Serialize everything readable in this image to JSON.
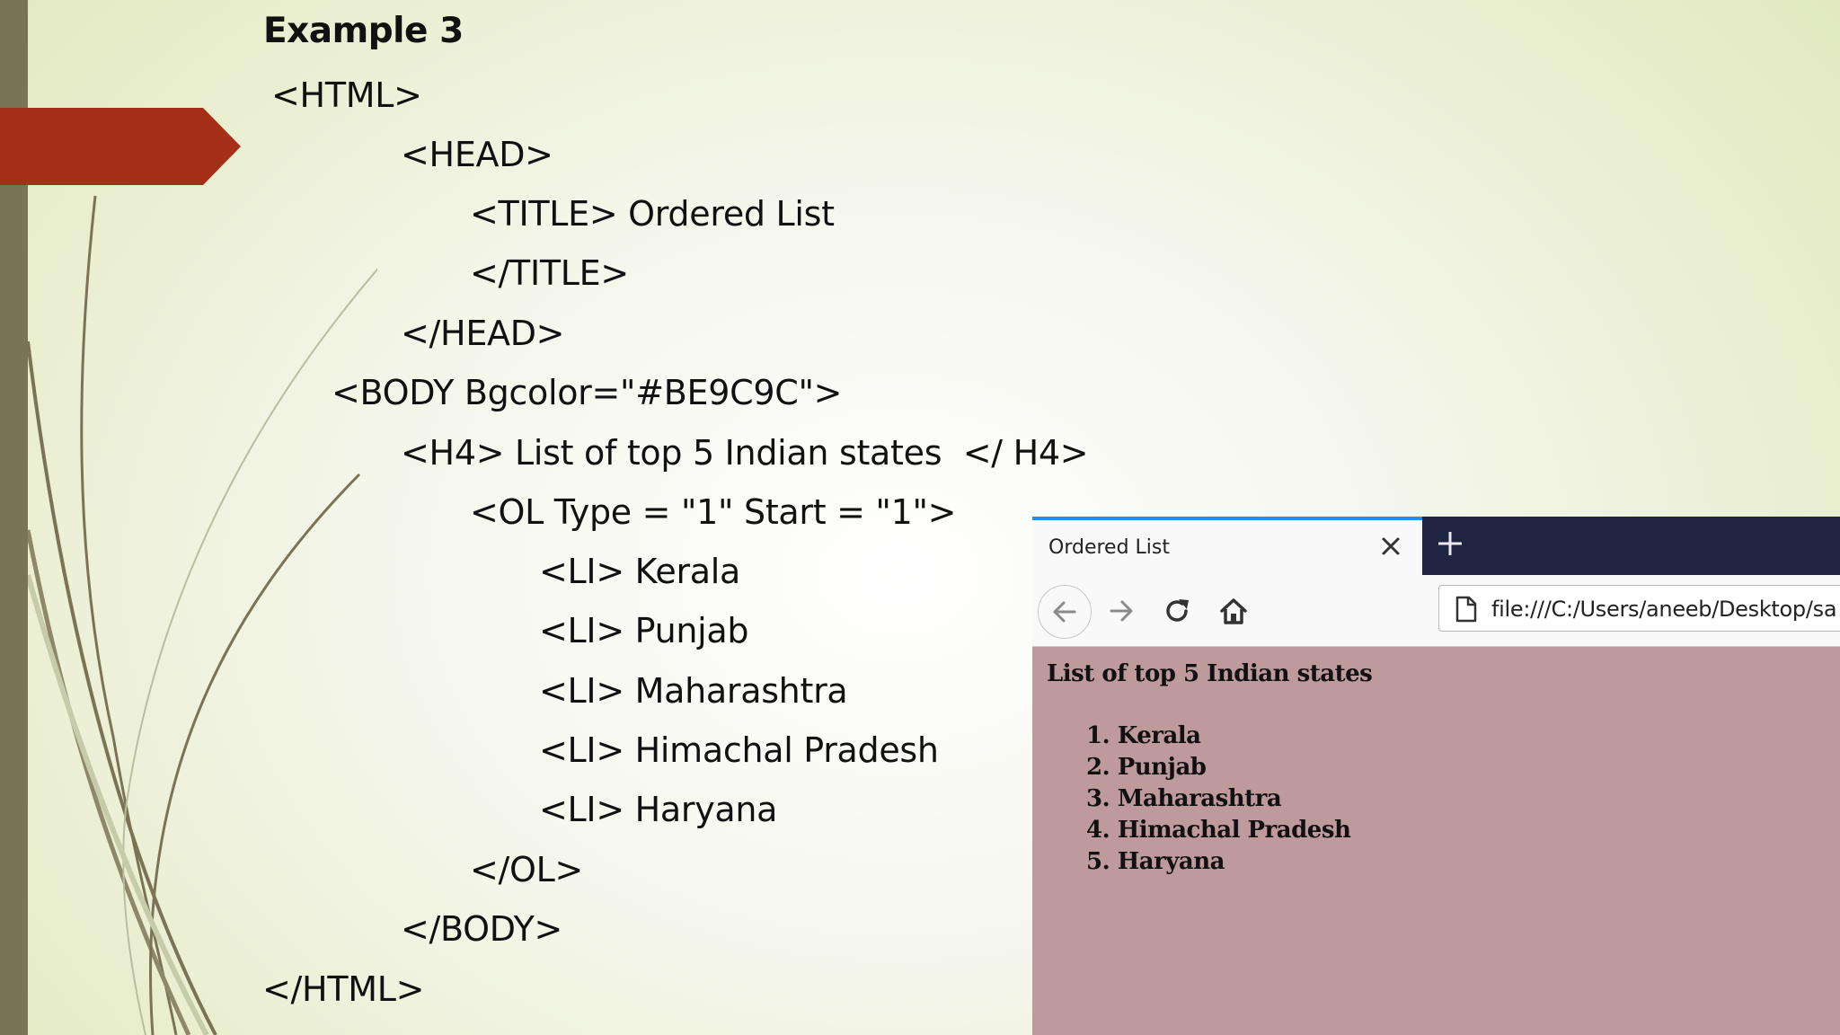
{
  "slide": {
    "title": "Example 3",
    "code_lines": [
      "<HTML>",
      "<HEAD>",
      "<TITLE> Ordered List",
      "</TITLE>",
      "</HEAD>",
      "<BODY Bgcolor=\"#BE9C9C\">",
      "<H4> List of top 5 Indian states  </ H4>",
      "<OL Type = \"1\" Start = \"1\">",
      "<LI> Kerala",
      "<LI> Punjab",
      "<LI> Maharashtra",
      "<LI> Himachal Pradesh",
      "<LI> Haryana",
      "</OL>",
      "</BODY>",
      "</HTML>"
    ],
    "colors": {
      "accent_arrow": "#a52f17",
      "left_bar": "#7b7356"
    }
  },
  "browser": {
    "tab_title": "Ordered List",
    "url": "file:///C:/Users/aneeb/Desktop/sa",
    "icons": {
      "close": "close-icon",
      "new_tab": "plus-icon",
      "back": "back-arrow-icon",
      "forward": "forward-arrow-icon",
      "reload": "reload-icon",
      "home": "home-icon",
      "page": "page-icon"
    },
    "page_bgcolor": "#BE9C9C",
    "page": {
      "heading": "List of top 5 Indian states",
      "items": [
        "1. Kerala",
        "2. Punjab",
        "3. Maharashtra",
        "4. Himachal Pradesh",
        "5. Haryana"
      ]
    }
  }
}
